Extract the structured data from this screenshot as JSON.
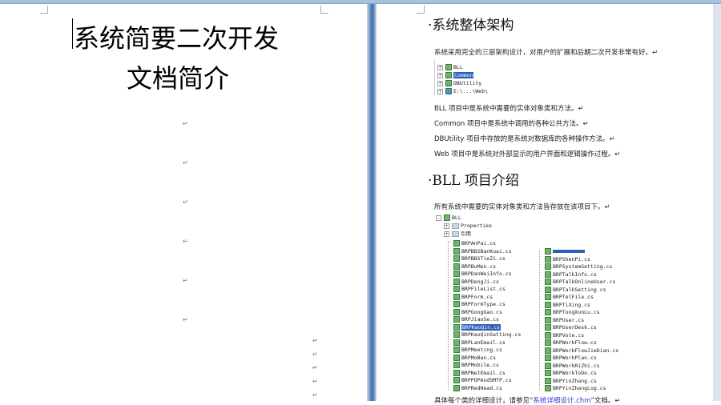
{
  "page1": {
    "title_line1": "系统简要二次开发",
    "title_line2": "文档简介",
    "para_mark": "↵"
  },
  "page2": {
    "section1": {
      "heading": "·系统整体架构",
      "intro": "系统采用完全的三层架构设计，对用户的扩展和后期二次开发非常有好。↵",
      "projects": [
        "BLL",
        "Common",
        "DBUtility",
        "E:\\...\\Web\\"
      ],
      "selected_project": "Common",
      "descriptions": [
        "BLL 项目中是系统中需要的实体对象类和方法。↵",
        "Common 项目中是系统中调用的各种公共方法。↵",
        "DBUtility 项目中存放的是系统对数据库的各种操作方法。↵",
        "Web 项目中是系统对外部显示的用户界面和逻辑操作过程。↵"
      ]
    },
    "section2": {
      "heading": "·BLL 项目介绍",
      "intro": "所有系统中需要的实体对象类和方法皆存放在该项目下。↵",
      "root": "BLL",
      "folders": [
        "Properties",
        "引用"
      ],
      "files_left": [
        "BRPAnPai.cs",
        "BRPBBSBanKuai.cs",
        "BRPBBSTieZi.cs",
        "BRPBuMen.cs",
        "BRPDanWeiInfo.cs",
        "BRPDengJi.cs",
        "BRPFileList.cs",
        "BRPForm.cs",
        "BRPFormType.cs",
        "BRPGongGao.cs",
        "BRPJiaoSe.cs",
        "BRPKaoQin.cs",
        "BRPKaoQinSetting.cs",
        "BRPLanEmail.cs",
        "BRPMeeting.cs",
        "BRPMoBan.cs",
        "BRPMobile.cs",
        "BRPNetEmail.cs",
        "BRPPOPAndSMTP.cs",
        "BRPRedHead.cs"
      ],
      "files_right": [
        "",
        "BRPShenPi.cs",
        "BRPSystemSetting.cs",
        "BRPTalkInfo.cs",
        "BRPTalkOnlineUser.cs",
        "BRPTalkSetting.cs",
        "BRPTelFile.cs",
        "BRPTiXing.cs",
        "BRPTongXunLu.cs",
        "BRPUser.cs",
        "BRPUserDesk.cs",
        "BRPVote.cs",
        "BRPWorkFlow.cs",
        "BRPWorkFlowJieDian.cs",
        "BRPWorkPlan.cs",
        "BRPWorkRiZhi.cs",
        "BRPWorkToDo.cs",
        "BRPYinZhang.cs",
        "BRPYinZhangLog.cs"
      ],
      "selected_file": "BRPKaoQin.cs",
      "footer_pre": "具体每个类的详细设计，请参见“",
      "footer_link": "系统详细设计.chm",
      "footer_post": "”文档。↵"
    }
  }
}
